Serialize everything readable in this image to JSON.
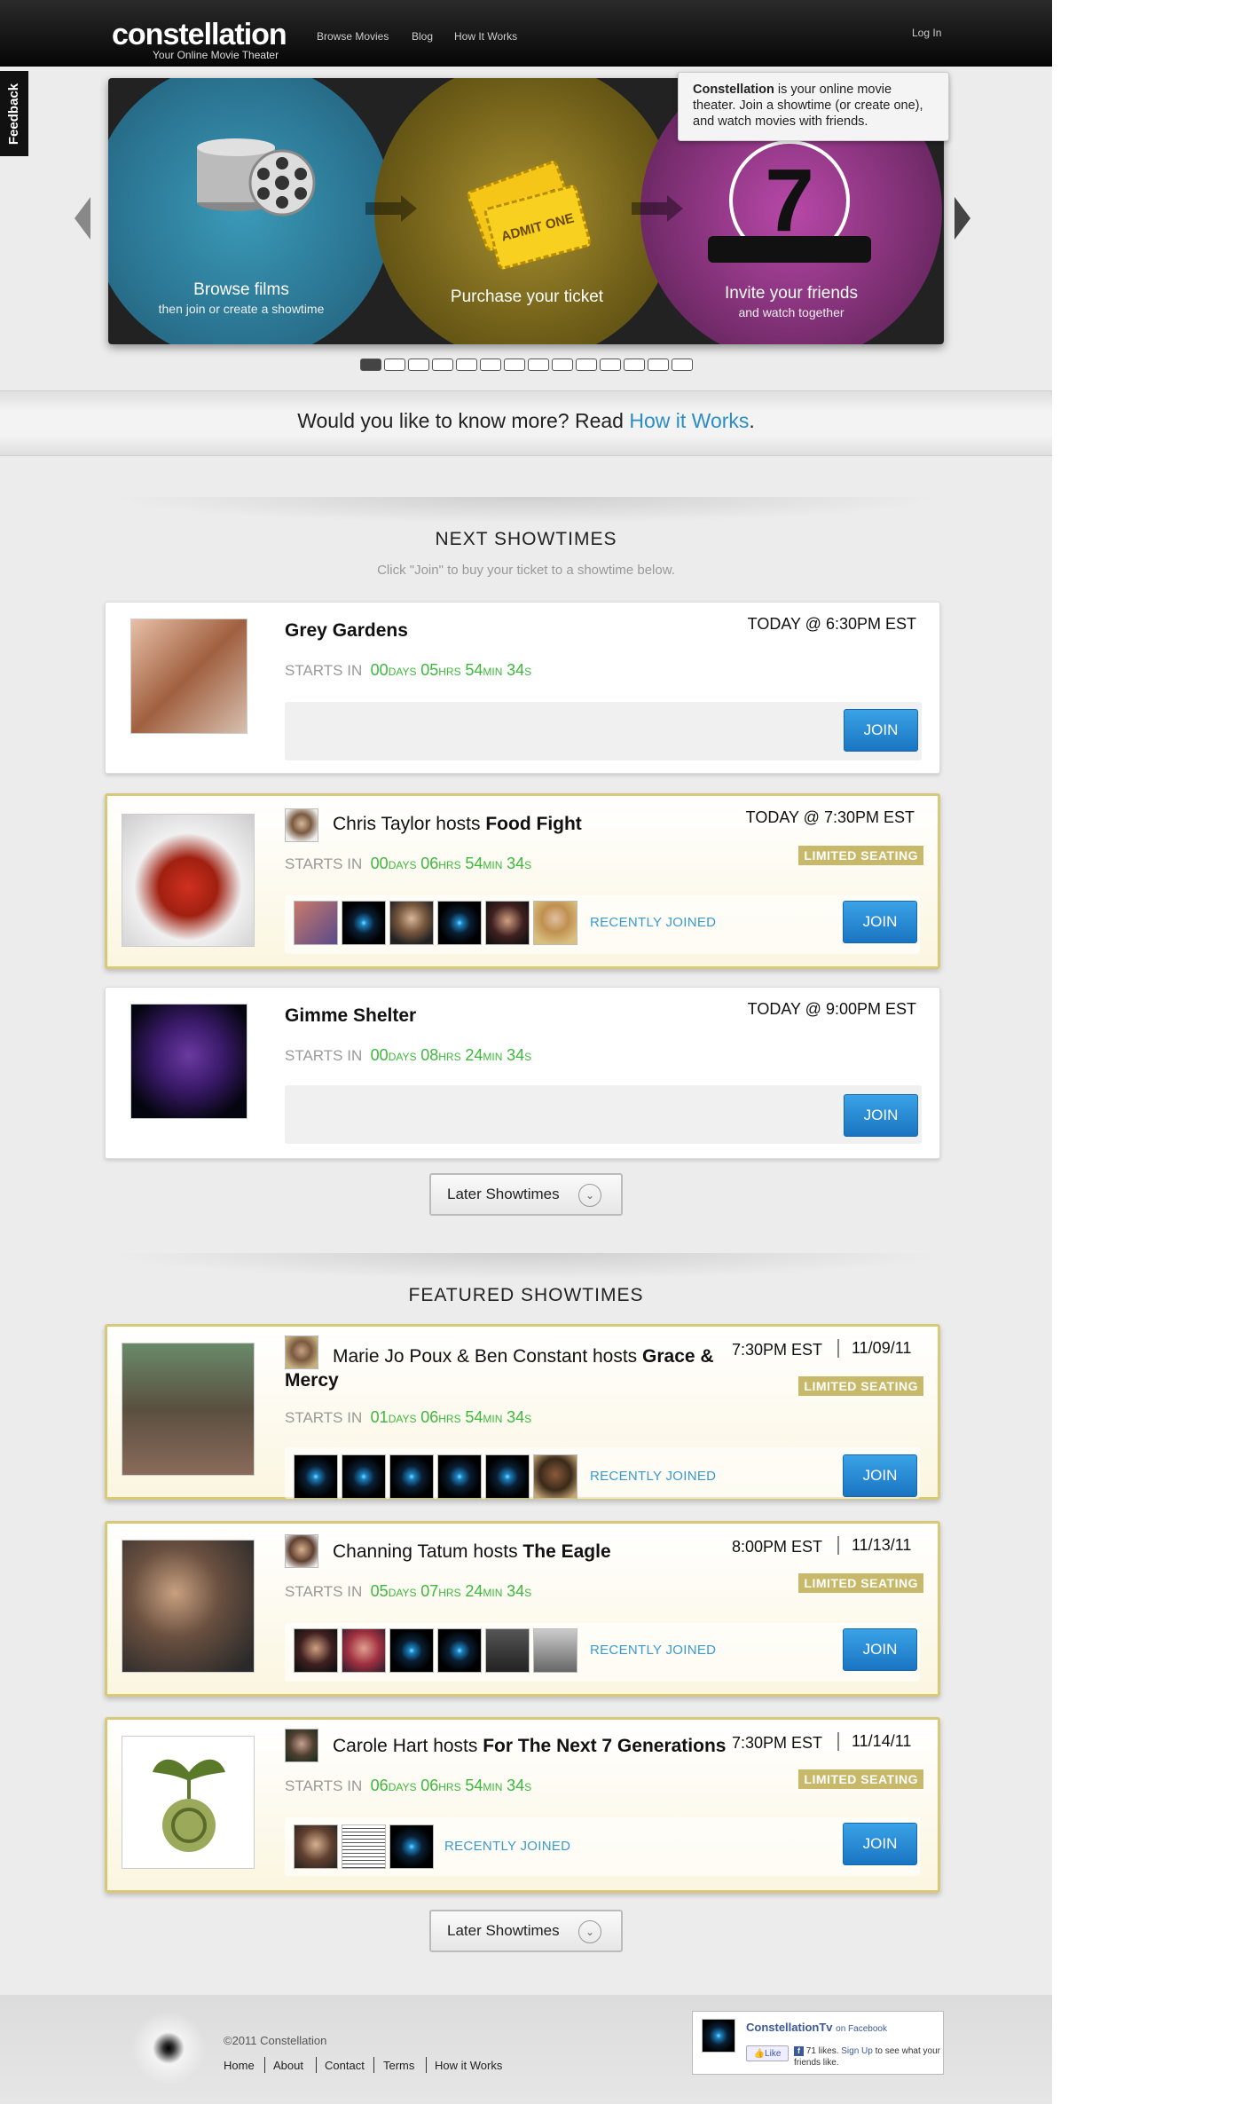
{
  "header": {
    "logo": "constellation",
    "tagline": "Your Online Movie Theater",
    "nav": [
      "Browse Movies",
      "Blog",
      "How It Works"
    ],
    "login": "Log In"
  },
  "feedback_tab": "Feedback",
  "hero": {
    "steps": [
      {
        "title": "Browse films",
        "sub": "then join or create a showtime"
      },
      {
        "title": "Purchase your ticket",
        "sub": ""
      },
      {
        "title": "Invite your friends",
        "sub": "and watch together"
      }
    ],
    "ticket_text": "ADMIT ONE",
    "countdown_digit": "7",
    "tooltip_bold": "Constellation",
    "tooltip_rest": " is your online movie theater. Join a showtime (or create one), and watch movies with friends.",
    "slide_count": 14,
    "active_slide": 1
  },
  "banner": {
    "text_before": "Would you like to know more? Read ",
    "link": "How it Works",
    "text_after": "."
  },
  "next_showtimes": {
    "title": "NEXT SHOWTIMES",
    "subtitle": "Click \"Join\" to buy your ticket to a showtime below.",
    "starts_label": "STARTS IN",
    "join_label": "JOIN",
    "limited_label": "LIMITED SEATING",
    "recent_label": "RECENTLY JOINED",
    "items": [
      {
        "title": "Grey Gardens",
        "time": "TODAY @ 6:30PM EST",
        "days": "00",
        "hrs": "05",
        "min": "54",
        "s": "34"
      },
      {
        "host": "Chris Taylor hosts ",
        "title": "Food Fight",
        "time": "TODAY @ 7:30PM EST",
        "days": "00",
        "hrs": "06",
        "min": "54",
        "s": "34"
      },
      {
        "title": "Gimme Shelter",
        "time": "TODAY @ 9:00PM EST",
        "days": "00",
        "hrs": "08",
        "min": "24",
        "s": "34"
      }
    ],
    "later": "Later Showtimes"
  },
  "units": {
    "days": "DAYS",
    "hrs": "HRS",
    "min": "MIN",
    "s": "S"
  },
  "featured_showtimes": {
    "title": "FEATURED SHOWTIMES",
    "items": [
      {
        "host": "Marie Jo Poux & Ben Constant hosts ",
        "title": "Grace & Mercy",
        "time": "7:30PM EST",
        "date": "11/09/11",
        "days": "01",
        "hrs": "06",
        "min": "54",
        "s": "34"
      },
      {
        "host": "Channing Tatum hosts ",
        "title": "The Eagle",
        "time": "8:00PM EST",
        "date": "11/13/11",
        "days": "05",
        "hrs": "07",
        "min": "24",
        "s": "34"
      },
      {
        "host": "Carole Hart hosts ",
        "title": "For The Next 7 Generations",
        "time": "7:30PM EST",
        "date": "11/14/11",
        "days": "06",
        "hrs": "06",
        "min": "54",
        "s": "34"
      }
    ],
    "later": "Later Showtimes"
  },
  "footer": {
    "copyright": "©2011 Constellation",
    "links": [
      "Home",
      "About",
      "Contact",
      "Terms",
      "How it Works"
    ],
    "fb_name": "ConstellationTv",
    "fb_on": "on Facebook",
    "fb_like": "Like",
    "fb_count": "71 likes.",
    "fb_signup": "Sign Up",
    "fb_rest": "to see what your friends like."
  },
  "colors": {
    "accent_blue": "#2a8dc5",
    "countdown_green": "#3db83d",
    "limited_gold": "#c8b96a",
    "join_blue": "#1a74c2"
  }
}
